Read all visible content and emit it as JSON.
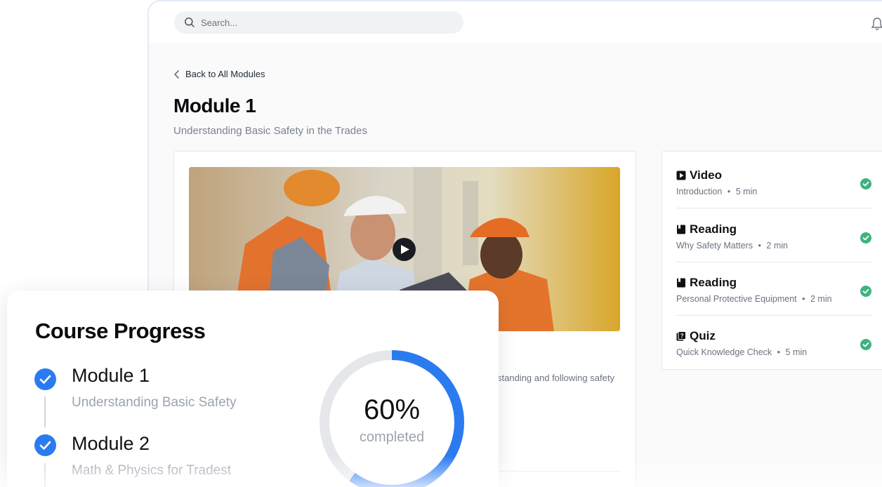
{
  "header": {
    "search_placeholder": "Search...",
    "icons": [
      "search-icon",
      "bell-icon"
    ]
  },
  "module": {
    "back_label": "Back to All Modules",
    "title": "Module 1",
    "subtitle": "Understanding Basic Safety in the Trades",
    "description_fragment": "standing and following safety"
  },
  "lessons": [
    {
      "type": "Video",
      "icon": "video-icon",
      "name": "Introduction",
      "duration": "5 min",
      "completed": true
    },
    {
      "type": "Reading",
      "icon": "book-icon",
      "name": "Why Safety Matters",
      "duration": "2 min",
      "completed": true
    },
    {
      "type": "Reading",
      "icon": "book-icon",
      "name": "Personal Protective Equipment",
      "duration": "2 min",
      "completed": true
    },
    {
      "type": "Quiz",
      "icon": "quiz-icon",
      "name": "Quick Knowledge Check",
      "duration": "5 min",
      "completed": true
    }
  ],
  "lesson_separator": "•",
  "progress": {
    "title": "Course Progress",
    "modules": [
      {
        "title": "Module 1",
        "subtitle": "Understanding Basic Safety",
        "completed": true
      },
      {
        "title": "Module 2",
        "subtitle": "Math & Physics for Tradest",
        "completed": true
      }
    ],
    "percent": 60,
    "percent_label": "60%",
    "completed_label": "completed"
  },
  "colors": {
    "accent_blue": "#2b7bf0",
    "check_green": "#3fb37f",
    "ring_track": "#e5e7eb"
  }
}
